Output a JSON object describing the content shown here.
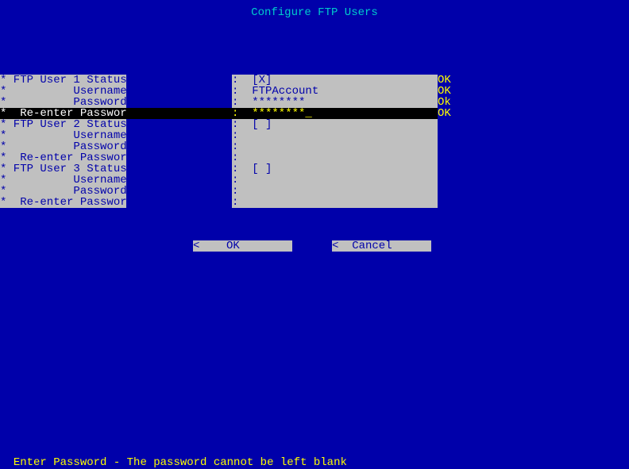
{
  "header": {
    "title": "Configure FTP Users"
  },
  "rows": [
    {
      "label": "* FTP User 1 Status",
      "value": ":  [X]",
      "status": "OK",
      "selected": false
    },
    {
      "label": "*          Username",
      "value": ":  FTPAccount",
      "status": "OK",
      "selected": false
    },
    {
      "label": "*          Password",
      "value": ":  ********",
      "status": "Ok",
      "selected": false
    },
    {
      "label": "*  Re-enter Password",
      "value": ":  ********_",
      "status": "OK",
      "selected": true
    },
    {
      "label": "* FTP User 2 Status",
      "value": ":  [ ]",
      "status": "",
      "selected": false
    },
    {
      "label": "*          Username",
      "value": ":",
      "status": "",
      "selected": false
    },
    {
      "label": "*          Password",
      "value": ":",
      "status": "",
      "selected": false
    },
    {
      "label": "*  Re-enter Password",
      "value": ":",
      "status": "",
      "selected": false
    },
    {
      "label": "* FTP User 3 Status",
      "value": ":  [ ]",
      "status": "",
      "selected": false
    },
    {
      "label": "*          Username",
      "value": ":",
      "status": "",
      "selected": false
    },
    {
      "label": "*          Password",
      "value": ":",
      "status": "",
      "selected": false
    },
    {
      "label": "*  Re-enter Password",
      "value": ":",
      "status": "",
      "selected": false
    }
  ],
  "buttons": {
    "ok": "<    OK        >",
    "cancel": "<  Cancel      >"
  },
  "footer": {
    "text": "Enter Password - The password cannot be left blank"
  }
}
